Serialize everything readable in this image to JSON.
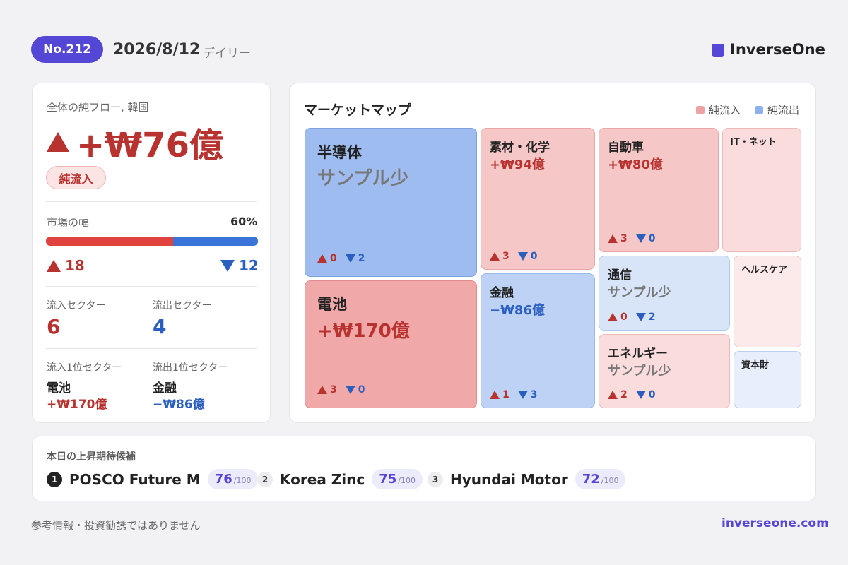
{
  "header": {
    "badge": "No.212",
    "date": "2026/8/12",
    "period": "デイリー",
    "brand": "InverseOne",
    "brand_color": "#5547d6"
  },
  "summary": {
    "label": "全体の純フロー, 韓国",
    "net_flow": "+₩76億",
    "direction_badge": "純流入",
    "breadth_label": "市場の幅",
    "breadth_pct_label": "60%",
    "breadth_fraction": 0.6,
    "up_count": "18",
    "down_count": "12",
    "inflow_sectors_label": "流入セクター",
    "inflow_sectors": "6",
    "outflow_sectors_label": "流出セクター",
    "outflow_sectors": "4",
    "top_inflow_label": "流入1位セクター",
    "top_inflow_name": "電池",
    "top_inflow_value": "+₩170億",
    "top_outflow_label": "流出1位セクター",
    "top_outflow_name": "金融",
    "top_outflow_value": "−₩86億",
    "inflow_color": "#b8332f",
    "outflow_color": "#2a5fc0"
  },
  "market_map": {
    "title": "マーケットマップ",
    "legend_inflow": "純流入",
    "legend_outflow": "純流出",
    "tiles": [
      {
        "name": "半導体",
        "value": "サンプル少",
        "up": "0",
        "down": "2"
      },
      {
        "name": "電池",
        "value": "+₩170億",
        "up": "3",
        "down": "0"
      },
      {
        "name": "素材・化学",
        "value": "+₩94億",
        "up": "3",
        "down": "0"
      },
      {
        "name": "金融",
        "value": "−₩86億",
        "up": "1",
        "down": "3"
      },
      {
        "name": "自動車",
        "value": "+₩80億",
        "up": "3",
        "down": "0"
      },
      {
        "name": "IT・ネット"
      },
      {
        "name": "通信",
        "value": "サンプル少",
        "up": "0",
        "down": "2"
      },
      {
        "name": "ヘルスケア"
      },
      {
        "name": "エネルギー",
        "value": "サンプル少",
        "up": "2",
        "down": "0"
      },
      {
        "name": "資本財"
      }
    ]
  },
  "candidates": {
    "title": "本日の上昇期待候補",
    "items": [
      {
        "rank": "1",
        "name": "POSCO Future M",
        "score": "76",
        "max": "/100"
      },
      {
        "rank": "2",
        "name": "Korea Zinc",
        "score": "75",
        "max": "/100"
      },
      {
        "rank": "3",
        "name": "Hyundai Motor",
        "score": "72",
        "max": "/100"
      }
    ]
  },
  "footer": {
    "disclaimer": "参考情報・投資勧誘ではありません",
    "url": "inverseone.com"
  }
}
